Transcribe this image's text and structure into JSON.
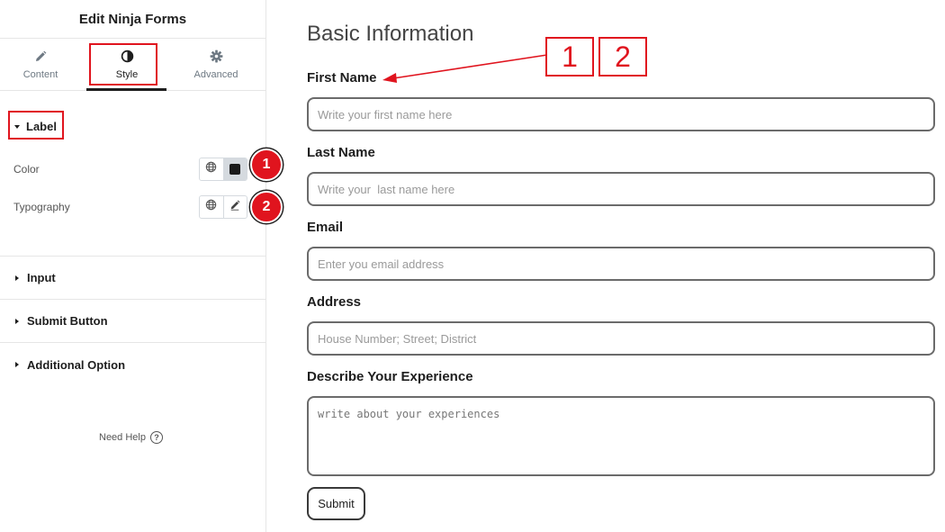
{
  "sidebar": {
    "title": "Edit Ninja Forms",
    "tabs": [
      {
        "label": "Content",
        "icon": "pencil-icon"
      },
      {
        "label": "Style",
        "icon": "half-circle-icon"
      },
      {
        "label": "Advanced",
        "icon": "gear-icon"
      }
    ],
    "label_section": {
      "title": "Label",
      "color_label": "Color",
      "typography_label": "Typography"
    },
    "collapsed_sections": [
      "Input",
      "Submit Button",
      "Additional Option"
    ],
    "help_label": "Need Help",
    "help_icon_text": "?"
  },
  "badges": {
    "one": "1",
    "two": "2"
  },
  "annotations": {
    "box1": "1",
    "box2": "2"
  },
  "form": {
    "title": "Basic Information",
    "first_name": {
      "label": "First Name",
      "placeholder": "Write your first name here"
    },
    "last_name": {
      "label": "Last Name",
      "placeholder": "Write your  last name here"
    },
    "email": {
      "label": "Email",
      "placeholder": "Enter you email address"
    },
    "address": {
      "label": "Address",
      "placeholder": "House Number; Street; District"
    },
    "experience": {
      "label": "Describe Your Experience",
      "placeholder": "write about your experiences"
    },
    "submit_label": "Submit"
  },
  "colors": {
    "accent_red": "#e0141e",
    "label_swatch": "#1a1a1a"
  }
}
